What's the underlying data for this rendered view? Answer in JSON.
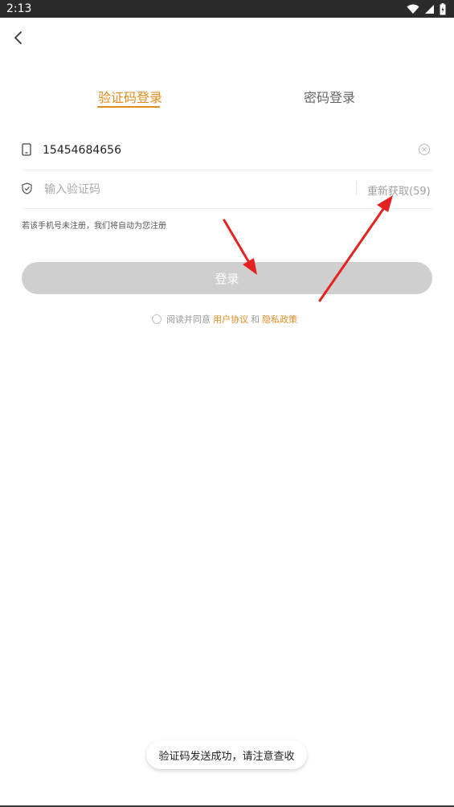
{
  "status_bar": {
    "time": "2:13",
    "icons": [
      "wifi-icon",
      "signal-icon",
      "battery-icon"
    ]
  },
  "tabs": {
    "sms_login": "验证码登录",
    "password_login": "密码登录"
  },
  "phone": {
    "value": "15454684656"
  },
  "verification": {
    "placeholder": "输入验证码",
    "resend_label": "重新获取(59)"
  },
  "notice": "若该手机号未注册，我们将自动为您注册",
  "login_button": "登录",
  "agreement": {
    "prefix": "阅读并同意",
    "user_agreement": "用户协议",
    "and": "和",
    "privacy_policy": "隐私政策"
  },
  "toast": "验证码发送成功，请注意查收",
  "colors": {
    "accent": "#e38b1d",
    "button_disabled": "#cfcfcf",
    "annotation_arrow": "#e52222"
  }
}
